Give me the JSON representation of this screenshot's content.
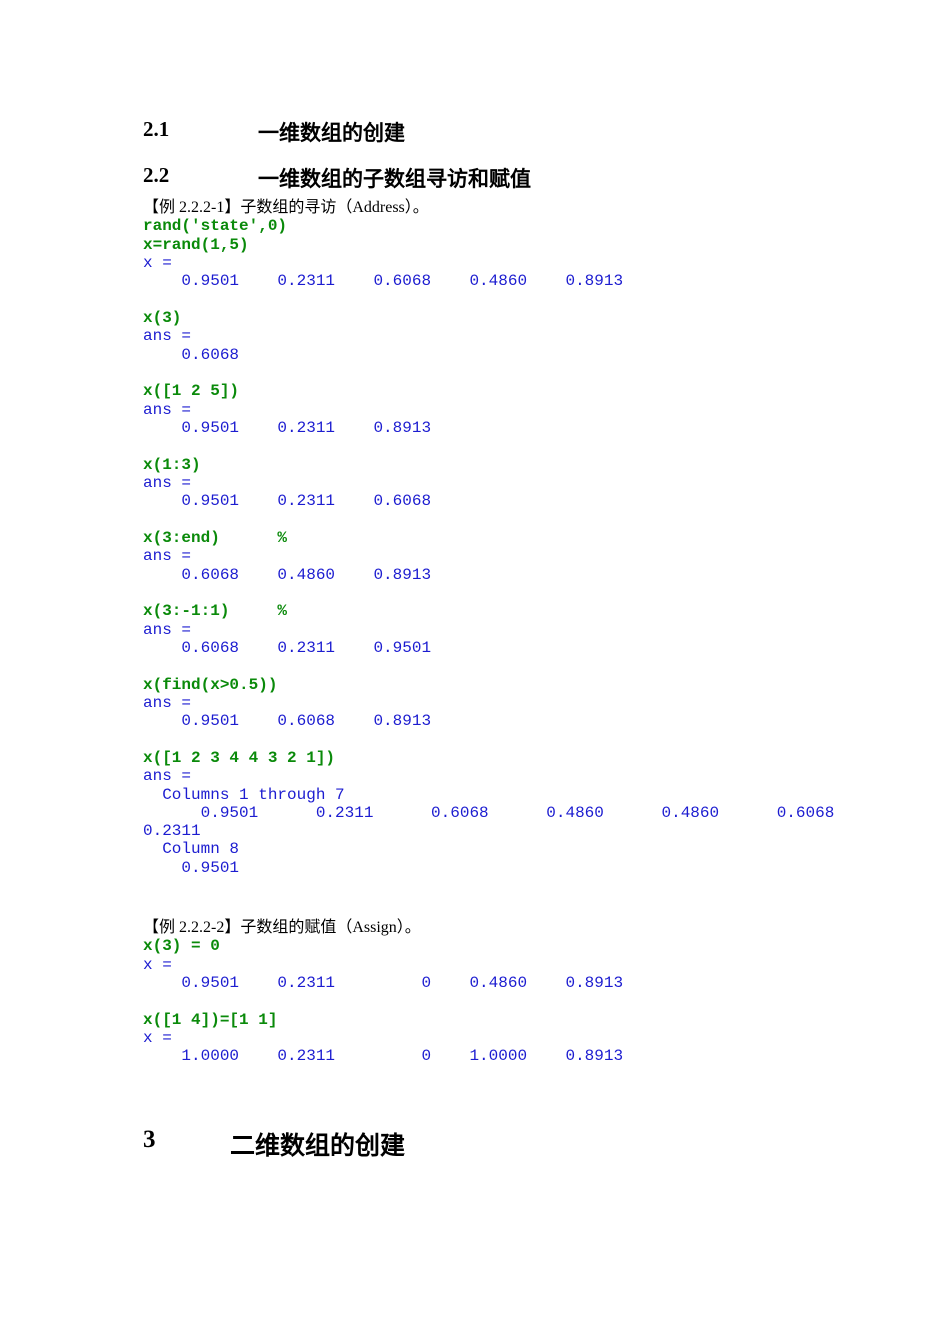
{
  "headings": {
    "h21": {
      "num": "2.1",
      "title": "一维数组的创建"
    },
    "h22": {
      "num": "2.2",
      "title": "一维数组的子数组寻访和赋值"
    },
    "h3": {
      "num": "3",
      "title": "二维数组的创建"
    }
  },
  "example1": [
    {
      "t": "cap",
      "s": "【例 2.2.2-1】子数组的寻访（Address）。"
    },
    {
      "t": "cmd",
      "s": "rand('state',0)"
    },
    {
      "t": "cmd",
      "s": "x=rand(1,5)"
    },
    {
      "t": "out",
      "s": "x ="
    },
    {
      "t": "out",
      "s": "    0.9501    0.2311    0.6068    0.4860    0.8913"
    },
    {
      "t": "out",
      "s": ""
    },
    {
      "t": "cmd",
      "s": "x(3)"
    },
    {
      "t": "out",
      "s": "ans ="
    },
    {
      "t": "out",
      "s": "    0.6068"
    },
    {
      "t": "out",
      "s": ""
    },
    {
      "t": "cmd",
      "s": "x([1 2 5])"
    },
    {
      "t": "out",
      "s": "ans ="
    },
    {
      "t": "out",
      "s": "    0.9501    0.2311    0.8913"
    },
    {
      "t": "out",
      "s": ""
    },
    {
      "t": "cmd",
      "s": "x(1:3)"
    },
    {
      "t": "out",
      "s": "ans ="
    },
    {
      "t": "out",
      "s": "    0.9501    0.2311    0.6068"
    },
    {
      "t": "out",
      "s": ""
    },
    {
      "t": "cmd",
      "s": "x(3:end)      %"
    },
    {
      "t": "out",
      "s": "ans ="
    },
    {
      "t": "out",
      "s": "    0.6068    0.4860    0.8913"
    },
    {
      "t": "out",
      "s": ""
    },
    {
      "t": "cmd",
      "s": "x(3:-1:1)     %"
    },
    {
      "t": "out",
      "s": "ans ="
    },
    {
      "t": "out",
      "s": "    0.6068    0.2311    0.9501"
    },
    {
      "t": "out",
      "s": ""
    },
    {
      "t": "cmd",
      "s": "x(find(x>0.5))"
    },
    {
      "t": "out",
      "s": "ans ="
    },
    {
      "t": "out",
      "s": "    0.9501    0.6068    0.8913"
    },
    {
      "t": "out",
      "s": ""
    },
    {
      "t": "cmd",
      "s": "x([1 2 3 4 4 3 2 1])"
    },
    {
      "t": "out",
      "s": "ans ="
    },
    {
      "t": "out",
      "s": "  Columns 1 through 7"
    },
    {
      "t": "out",
      "s": "      0.9501      0.2311      0.6068      0.4860      0.4860      0.6068"
    },
    {
      "t": "out",
      "s": "0.2311"
    },
    {
      "t": "out",
      "s": "  Column 8"
    },
    {
      "t": "out",
      "s": "    0.9501"
    }
  ],
  "example2": [
    {
      "t": "cap",
      "s": "【例 2.2.2-2】子数组的赋值（Assign）。"
    },
    {
      "t": "cmd",
      "s": "x(3) = 0"
    },
    {
      "t": "out",
      "s": "x ="
    },
    {
      "t": "out",
      "s": "    0.9501    0.2311         0    0.4860    0.8913"
    },
    {
      "t": "out",
      "s": ""
    },
    {
      "t": "cmd",
      "s": "x([1 4])=[1 1]"
    },
    {
      "t": "out",
      "s": "x ="
    },
    {
      "t": "out",
      "s": "    1.0000    0.2311         0    1.0000    0.8913"
    }
  ],
  "colors": {
    "command": "#0a8a0a",
    "output": "#1c1cd0"
  }
}
